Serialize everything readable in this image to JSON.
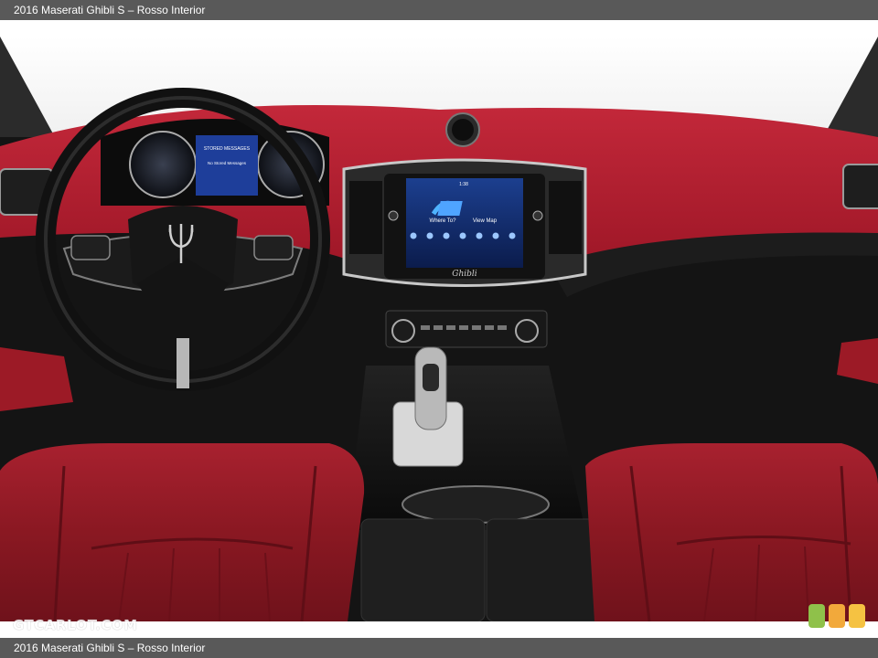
{
  "header": {
    "caption": "2016 Maserati Ghibli S – Rosso Interior"
  },
  "footer": {
    "caption": "2016 Maserati Ghibli S – Rosso Interior"
  },
  "photo": {
    "subject": "dashboard-interior",
    "screen": {
      "nav_items": [
        "Where To?",
        "View Map"
      ],
      "brand_script": "Ghibli",
      "status_time": "1:38"
    },
    "cluster_text": [
      "STORED MESSAGES",
      "No Stored Messages"
    ]
  },
  "watermark": {
    "text": "GTCARLOT.COM"
  },
  "colors": {
    "bar": "#595959",
    "leather": "#b11d2b",
    "logo": [
      "#8fc14a",
      "#f2a93b",
      "#f5c242"
    ]
  }
}
